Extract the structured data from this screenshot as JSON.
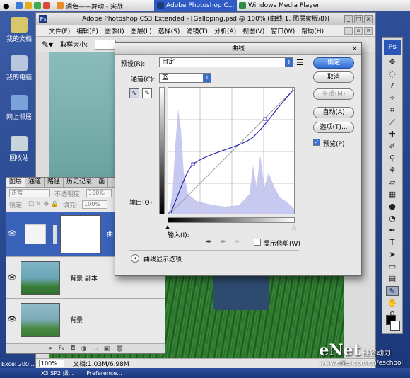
{
  "topbar": {
    "items": [
      {
        "label": "调色——舞动 - 实战...",
        "active": false
      },
      {
        "label": "Adobe Photoshop C...",
        "active": true
      },
      {
        "label": "Windows Media Player",
        "active": false
      }
    ]
  },
  "desktop": {
    "icons": [
      "我的文档",
      "我的电脑",
      "网上邻居",
      "回收站"
    ],
    "excel_label": "Excel 200...",
    "taskbar": [
      "X3 SP2 绿...",
      "Preference..."
    ]
  },
  "photoshop": {
    "window_title": "Adobe Photoshop CS3 Extended - [Galloping.psd @ 100% (曲线 1, 图层蒙版/8)]",
    "menu": [
      "文件(F)",
      "编辑(E)",
      "图像(I)",
      "图层(L)",
      "选择(S)",
      "滤镜(T)",
      "分析(A)",
      "视图(V)",
      "窗口(W)",
      "帮助(H)"
    ],
    "options_label": "取样大小:",
    "status": {
      "zoom": "100%",
      "doc": "文档:1.03M/6.98M"
    }
  },
  "layers_panel": {
    "tabs": [
      "图层",
      "通道",
      "路径",
      "历史记录",
      "画"
    ],
    "blend_mode": "正常",
    "opacity_label": "不透明度:",
    "opacity_value": "100%",
    "lock_label": "锁定:",
    "fill_label": "填充:",
    "fill_value": "100%",
    "layers": [
      {
        "name": "曲",
        "selected": true
      },
      {
        "name": "背景 副本",
        "selected": false
      },
      {
        "name": "背景",
        "selected": false
      }
    ]
  },
  "curves_dialog": {
    "title": "曲线",
    "preset_label": "预设(R):",
    "preset_value": "自定",
    "channel_label": "通道(C):",
    "channel_value": "蓝",
    "output_label": "输出(O):",
    "input_label": "输入(I):",
    "show_clipping_label": "显示修剪(W)",
    "curve_options_label": "曲线显示选项",
    "buttons": {
      "ok": "确定",
      "cancel": "取消",
      "smooth": "平滑(M)",
      "auto": "自动(A)",
      "options": "选项(T)...",
      "preview": "预览(P)"
    },
    "preview_checked": true
  },
  "watermark": {
    "brand": "eNet",
    "url": "www.eNet.com.cn/eschool",
    "suffix": "硅谷动力"
  },
  "colors": {
    "accent": "#2c6ad6",
    "selected_layer": "#3b62b9",
    "curve": "#2a2aa8",
    "histogram": "#c7c9f0"
  }
}
